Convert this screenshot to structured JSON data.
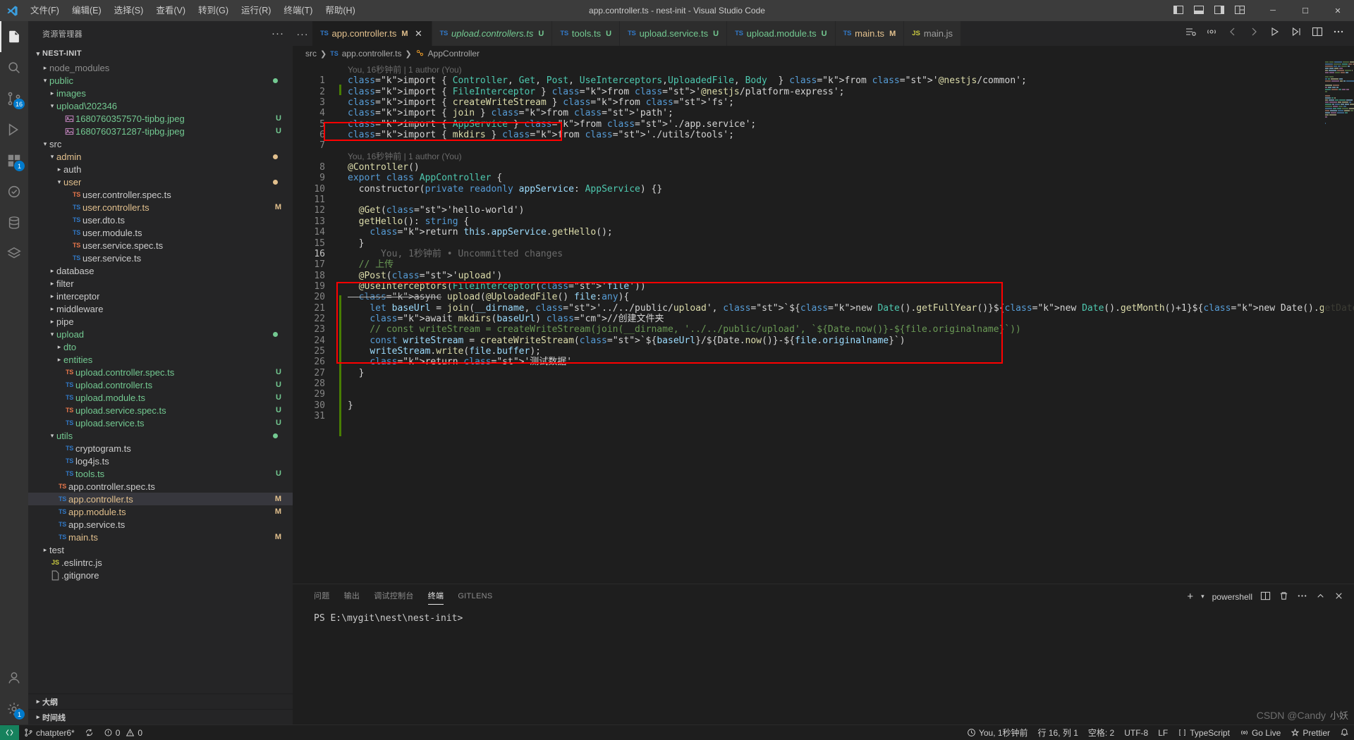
{
  "titlebar": {
    "window_title": "app.controller.ts - nest-init - Visual Studio Code",
    "menus": [
      "文件(F)",
      "编辑(E)",
      "选择(S)",
      "查看(V)",
      "转到(G)",
      "运行(R)",
      "终端(T)",
      "帮助(H)"
    ],
    "window_controls": {
      "minimize": "─",
      "maximize": "☐",
      "close": "✕"
    }
  },
  "activitybar": {
    "explorer_badge": "16",
    "extensions_badge": "1",
    "settings_badge": "1"
  },
  "sidebar": {
    "title": "资源管理器",
    "more_actions": "···",
    "project_name": "NEST-INIT",
    "outline_label": "大纲",
    "timeline_label": "时间线",
    "tree": [
      {
        "label": "node_modules",
        "type": "folder",
        "collapsed": true,
        "indent": 1,
        "color": "gray"
      },
      {
        "label": "public",
        "type": "folder",
        "collapsed": false,
        "indent": 1,
        "color": "green",
        "dot": "#73c991"
      },
      {
        "label": "images",
        "type": "folder",
        "collapsed": true,
        "indent": 2,
        "color": "green"
      },
      {
        "label": "upload\\202346",
        "type": "folder",
        "collapsed": false,
        "indent": 2,
        "color": "green"
      },
      {
        "label": "1680760357570-tipbg.jpeg",
        "type": "image",
        "indent": 3,
        "color": "green",
        "badge": "U",
        "badge_color": "#73c991"
      },
      {
        "label": "1680760371287-tipbg.jpeg",
        "type": "image",
        "indent": 3,
        "color": "green",
        "badge": "U",
        "badge_color": "#73c991"
      },
      {
        "label": "src",
        "type": "folder",
        "collapsed": false,
        "indent": 1,
        "color": "default"
      },
      {
        "label": "admin",
        "type": "folder",
        "collapsed": false,
        "indent": 2,
        "color": "orange",
        "dot": "#e2c08d"
      },
      {
        "label": "auth",
        "type": "folder",
        "collapsed": true,
        "indent": 3,
        "color": "default"
      },
      {
        "label": "user",
        "type": "folder",
        "collapsed": false,
        "indent": 3,
        "color": "orange",
        "dot": "#e2c08d"
      },
      {
        "label": "user.controller.spec.ts",
        "type": "ts-spec",
        "indent": 4,
        "color": "default"
      },
      {
        "label": "user.controller.ts",
        "type": "ts",
        "indent": 4,
        "color": "orange",
        "badge": "M",
        "badge_color": "#e2c08d"
      },
      {
        "label": "user.dto.ts",
        "type": "ts",
        "indent": 4,
        "color": "default"
      },
      {
        "label": "user.module.ts",
        "type": "ts",
        "indent": 4,
        "color": "default"
      },
      {
        "label": "user.service.spec.ts",
        "type": "ts-spec",
        "indent": 4,
        "color": "default"
      },
      {
        "label": "user.service.ts",
        "type": "ts",
        "indent": 4,
        "color": "default"
      },
      {
        "label": "database",
        "type": "folder",
        "collapsed": true,
        "indent": 2,
        "color": "default"
      },
      {
        "label": "filter",
        "type": "folder",
        "collapsed": true,
        "indent": 2,
        "color": "default"
      },
      {
        "label": "interceptor",
        "type": "folder",
        "collapsed": true,
        "indent": 2,
        "color": "default"
      },
      {
        "label": "middleware",
        "type": "folder",
        "collapsed": true,
        "indent": 2,
        "color": "default"
      },
      {
        "label": "pipe",
        "type": "folder",
        "collapsed": true,
        "indent": 2,
        "color": "default"
      },
      {
        "label": "upload",
        "type": "folder",
        "collapsed": false,
        "indent": 2,
        "color": "green",
        "dot": "#73c991"
      },
      {
        "label": "dto",
        "type": "folder",
        "collapsed": true,
        "indent": 3,
        "color": "green"
      },
      {
        "label": "entities",
        "type": "folder",
        "collapsed": true,
        "indent": 3,
        "color": "green"
      },
      {
        "label": "upload.controller.spec.ts",
        "type": "ts-spec",
        "indent": 3,
        "color": "green",
        "badge": "U",
        "badge_color": "#73c991"
      },
      {
        "label": "upload.controller.ts",
        "type": "ts",
        "indent": 3,
        "color": "green",
        "badge": "U",
        "badge_color": "#73c991"
      },
      {
        "label": "upload.module.ts",
        "type": "ts",
        "indent": 3,
        "color": "green",
        "badge": "U",
        "badge_color": "#73c991"
      },
      {
        "label": "upload.service.spec.ts",
        "type": "ts-spec",
        "indent": 3,
        "color": "green",
        "badge": "U",
        "badge_color": "#73c991"
      },
      {
        "label": "upload.service.ts",
        "type": "ts",
        "indent": 3,
        "color": "green",
        "badge": "U",
        "badge_color": "#73c991"
      },
      {
        "label": "utils",
        "type": "folder",
        "collapsed": false,
        "indent": 2,
        "color": "green",
        "dot": "#73c991"
      },
      {
        "label": "cryptogram.ts",
        "type": "ts",
        "indent": 3,
        "color": "default"
      },
      {
        "label": "log4js.ts",
        "type": "ts",
        "indent": 3,
        "color": "default"
      },
      {
        "label": "tools.ts",
        "type": "ts",
        "indent": 3,
        "color": "green",
        "badge": "U",
        "badge_color": "#73c991"
      },
      {
        "label": "app.controller.spec.ts",
        "type": "ts-spec",
        "indent": 2,
        "color": "default"
      },
      {
        "label": "app.controller.ts",
        "type": "ts",
        "indent": 2,
        "color": "orange",
        "badge": "M",
        "badge_color": "#e2c08d",
        "selected": true
      },
      {
        "label": "app.module.ts",
        "type": "ts",
        "indent": 2,
        "color": "orange",
        "badge": "M",
        "badge_color": "#e2c08d"
      },
      {
        "label": "app.service.ts",
        "type": "ts",
        "indent": 2,
        "color": "default"
      },
      {
        "label": "main.ts",
        "type": "ts",
        "indent": 2,
        "color": "orange",
        "badge": "M",
        "badge_color": "#e2c08d"
      },
      {
        "label": "test",
        "type": "folder",
        "collapsed": true,
        "indent": 1,
        "color": "default"
      },
      {
        "label": ".eslintrc.js",
        "type": "js",
        "indent": 1,
        "color": "default"
      },
      {
        "label": ".gitignore",
        "type": "file",
        "indent": 1,
        "color": "default"
      }
    ]
  },
  "tabs": [
    {
      "label": "app.controller.ts",
      "icon": "ts",
      "state": "M",
      "active": true,
      "closable": true,
      "style": "mod"
    },
    {
      "label": "upload.controllers.ts",
      "icon": "ts",
      "state": "U",
      "active": false,
      "style": "unt"
    },
    {
      "label": "tools.ts",
      "icon": "ts",
      "state": "U",
      "active": false,
      "style": "untn"
    },
    {
      "label": "upload.service.ts",
      "icon": "ts",
      "state": "U",
      "active": false,
      "style": "untn"
    },
    {
      "label": "upload.module.ts",
      "icon": "ts",
      "state": "U",
      "active": false,
      "style": "untn"
    },
    {
      "label": "main.ts",
      "icon": "ts",
      "state": "M",
      "active": false,
      "style": "mod"
    },
    {
      "label": "main.js",
      "icon": "js",
      "state": "",
      "active": false,
      "style": "plain"
    }
  ],
  "breadcrumb": [
    "src",
    "app.controller.ts",
    "AppController"
  ],
  "editor": {
    "blame_1": "You, 16秒钟前 | 1 author (You)",
    "blame_2": "You, 16秒钟前 | 1 author (You)",
    "blame_3": "You, 1秒钟前 • Uncommitted changes",
    "lines": [
      {
        "n": 1,
        "text": "import { Controller, Get, Post, UseInterceptors,UploadedFile, Body  } from '@nestjs/common';"
      },
      {
        "n": 2,
        "text": "import { FileInterceptor } from '@nestjs/platform-express';"
      },
      {
        "n": 3,
        "text": "import { createWriteStream } from 'fs';"
      },
      {
        "n": 4,
        "text": "import { join } from 'path';"
      },
      {
        "n": 5,
        "text": "import { AppService } from './app.service';"
      },
      {
        "n": 6,
        "text": "import { mkdirs } from './utils/tools';"
      },
      {
        "n": 7,
        "text": ""
      },
      {
        "n": 8,
        "text": "@Controller()"
      },
      {
        "n": 9,
        "text": "export class AppController {"
      },
      {
        "n": 10,
        "text": "  constructor(private readonly appService: AppService) {}"
      },
      {
        "n": 11,
        "text": ""
      },
      {
        "n": 12,
        "text": "  @Get('hello-world')"
      },
      {
        "n": 13,
        "text": "  getHello(): string {"
      },
      {
        "n": 14,
        "text": "    return this.appService.getHello();"
      },
      {
        "n": 15,
        "text": "  }"
      },
      {
        "n": 16,
        "text": ""
      },
      {
        "n": 17,
        "text": "  // 上传"
      },
      {
        "n": 18,
        "text": "  @Post('upload')"
      },
      {
        "n": 19,
        "text": "  @UseInterceptors(FileInterceptor('file'))"
      },
      {
        "n": 20,
        "text": "  async upload(@UploadedFile() file:any){"
      },
      {
        "n": 21,
        "text": "    let baseUrl = join(__dirname, '../../public/upload', `${new Date().getFullYear()}${new Date().getMonth()+1}${new Date().getDate()}`)"
      },
      {
        "n": 22,
        "text": "    await mkdirs(baseUrl) //创建文件夹"
      },
      {
        "n": 23,
        "text": "    // const writeStream = createWriteStream(join(__dirname, '../../public/upload', `${Date.now()}-${file.originalname}`))"
      },
      {
        "n": 24,
        "text": "    const writeStream = createWriteStream(`${baseUrl}/${Date.now()}-${file.originalname}`)"
      },
      {
        "n": 25,
        "text": "    writeStream.write(file.buffer);"
      },
      {
        "n": 26,
        "text": "    return '测试数据'"
      },
      {
        "n": 27,
        "text": "  }"
      },
      {
        "n": 28,
        "text": ""
      },
      {
        "n": 29,
        "text": ""
      },
      {
        "n": 30,
        "text": "}"
      },
      {
        "n": 31,
        "text": ""
      }
    ]
  },
  "panel": {
    "tabs": [
      "问题",
      "输出",
      "调试控制台",
      "终端",
      "GITLENS"
    ],
    "active_tab": "终端",
    "shell": "powershell",
    "add_icon": "+",
    "terminal_text": "PS E:\\mygit\\nest\\nest-init>"
  },
  "statusbar": {
    "remote": "",
    "branch": "chatpter6*",
    "sync": "",
    "errors": "0",
    "warnings": "0",
    "blame": "You, 1秒钟前",
    "cursor": "行 16, 列 1",
    "spaces": "空格: 2",
    "encoding": "UTF-8",
    "eol": "LF",
    "language": "TypeScript",
    "golive": "Go Live",
    "prettier": "Prettier",
    "bell": ""
  },
  "watermark": {
    "text": "CSDN @Candy",
    "suffix": "小妖"
  }
}
